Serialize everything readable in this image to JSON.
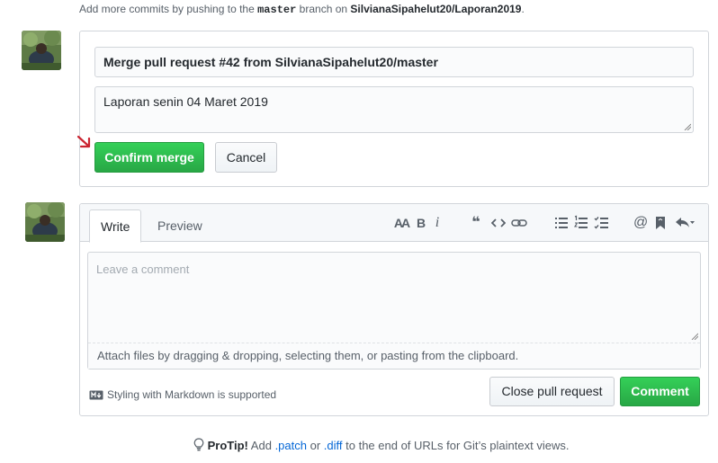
{
  "top_note": {
    "prefix": "Add more commits by pushing to the",
    "branch": "master",
    "middle": "branch on",
    "repo": "SilvianaSipahelut20/Laporan2019",
    "suffix": "."
  },
  "merge": {
    "title_value": "Merge pull request #42 from SilvianaSipahelut20/master",
    "body_value": "Laporan senin 04 Maret 2019",
    "confirm_label": "Confirm merge",
    "cancel_label": "Cancel"
  },
  "comment": {
    "tabs": [
      {
        "label": "Write",
        "active": true
      },
      {
        "label": "Preview",
        "active": false
      }
    ],
    "toolbar": [
      "header-icon",
      "bold-icon",
      "italic-icon",
      "quote-icon",
      "code-icon",
      "link-icon",
      "bulleted-list-icon",
      "numbered-list-icon",
      "task-list-icon",
      "mention-icon",
      "bookmark-icon",
      "reply-icon"
    ],
    "text": {
      "heading": "AA",
      "bold": "B",
      "italic": "i",
      "quote": "❝",
      "mention": "@"
    },
    "placeholder": "Leave a comment",
    "attach_text": "Attach files by dragging & dropping, selecting them, or pasting from the clipboard.",
    "markdown_note": "Styling with Markdown is supported",
    "close_label": "Close pull request",
    "comment_label": "Comment"
  },
  "protip": {
    "lead": "ProTip!",
    "text_1": "Add",
    "patch": ".patch",
    "or": "or",
    "diff": ".diff",
    "text_2": "to the end of URLs for Git’s plaintext views."
  },
  "colors": {
    "primary_green": "#28a745",
    "border": "#d1d5da",
    "link": "#0366d6",
    "arrow_red": "#cb2431"
  }
}
